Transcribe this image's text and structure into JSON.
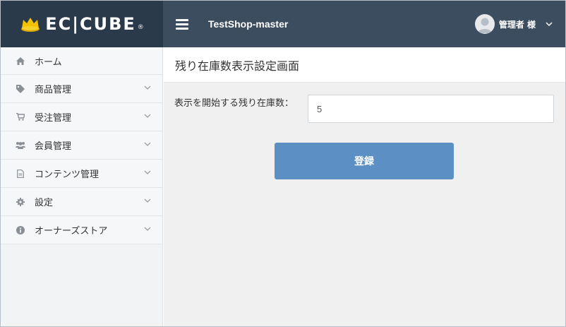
{
  "brand": {
    "logo_text": "EC|CUBE",
    "registered_mark": "®",
    "colors": {
      "dark": "#2b3a4a",
      "crown": "#f2c200"
    }
  },
  "header": {
    "shop_name": "TestShop-master",
    "user_name": "管理者 様",
    "menu_icon": "hamburger-icon",
    "bar_color": "#3c4d5f"
  },
  "sidebar": {
    "items": [
      {
        "label": "ホーム",
        "icon": "home-icon",
        "has_children": false
      },
      {
        "label": "商品管理",
        "icon": "tag-icon",
        "has_children": true
      },
      {
        "label": "受注管理",
        "icon": "cart-icon",
        "has_children": true
      },
      {
        "label": "会員管理",
        "icon": "users-icon",
        "has_children": true
      },
      {
        "label": "コンテンツ管理",
        "icon": "document-icon",
        "has_children": true
      },
      {
        "label": "設定",
        "icon": "gear-icon",
        "has_children": true
      },
      {
        "label": "オーナーズストア",
        "icon": "info-icon",
        "has_children": true
      }
    ]
  },
  "main": {
    "page_title": "残り在庫数表示設定画面",
    "form": {
      "label": "表示を開始する残り在庫数：",
      "value": "5"
    },
    "submit_label": "登録",
    "button_color": "#5c8fc3"
  }
}
